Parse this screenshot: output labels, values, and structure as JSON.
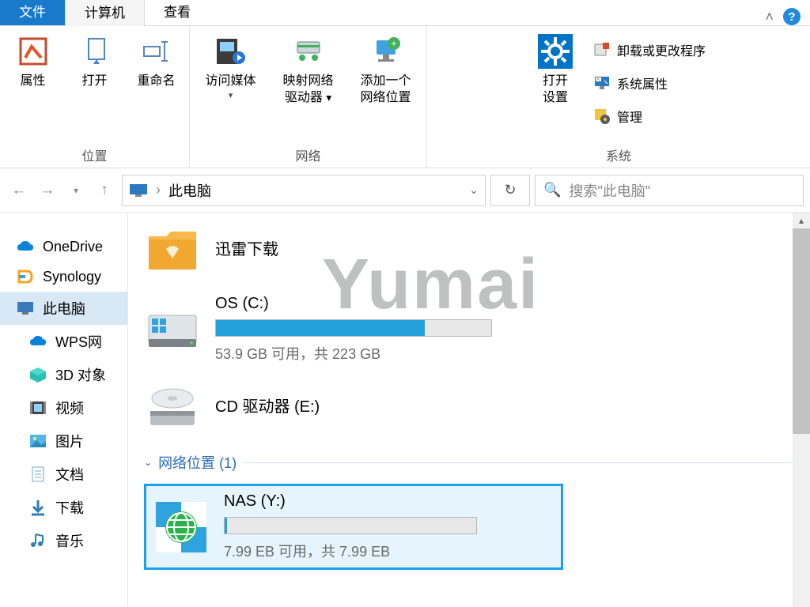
{
  "tabs": {
    "file": "文件",
    "computer": "计算机",
    "view": "查看"
  },
  "ribbon": {
    "location": {
      "label": "位置",
      "properties": "属性",
      "open": "打开",
      "rename": "重命名"
    },
    "network": {
      "label": "网络",
      "access_media": "访问媒体",
      "map_drive_l1": "映射网络",
      "map_drive_l2": "驱动器",
      "add_loc_l1": "添加一个",
      "add_loc_l2": "网络位置"
    },
    "system": {
      "label": "系统",
      "open_settings_l1": "打开",
      "open_settings_l2": "设置",
      "uninstall": "卸载或更改程序",
      "sys_props": "系统属性",
      "manage": "管理"
    }
  },
  "nav": {
    "breadcrumb": "此电脑",
    "search_placeholder": "搜索\"此电脑\""
  },
  "sidebar": {
    "onedrive": "OneDrive",
    "synology": "Synology",
    "thispc": "此电脑",
    "wps": "WPS网",
    "obj3d": "3D 对象",
    "video": "视频",
    "pictures": "图片",
    "docs": "文档",
    "downloads": "下载",
    "music": "音乐"
  },
  "content": {
    "xunlei": "迅雷下载",
    "drive_c": {
      "title": "OS (C:)",
      "sub": "53.9 GB 可用，共 223 GB",
      "fill_pct": 76
    },
    "drive_e": {
      "title": "CD 驱动器 (E:)"
    },
    "net_header": "网络位置 (1)",
    "nas": {
      "title": "NAS (Y:)",
      "sub": "7.99 EB 可用，共 7.99 EB",
      "fill_pct": 1
    }
  },
  "watermark": "Yumai"
}
